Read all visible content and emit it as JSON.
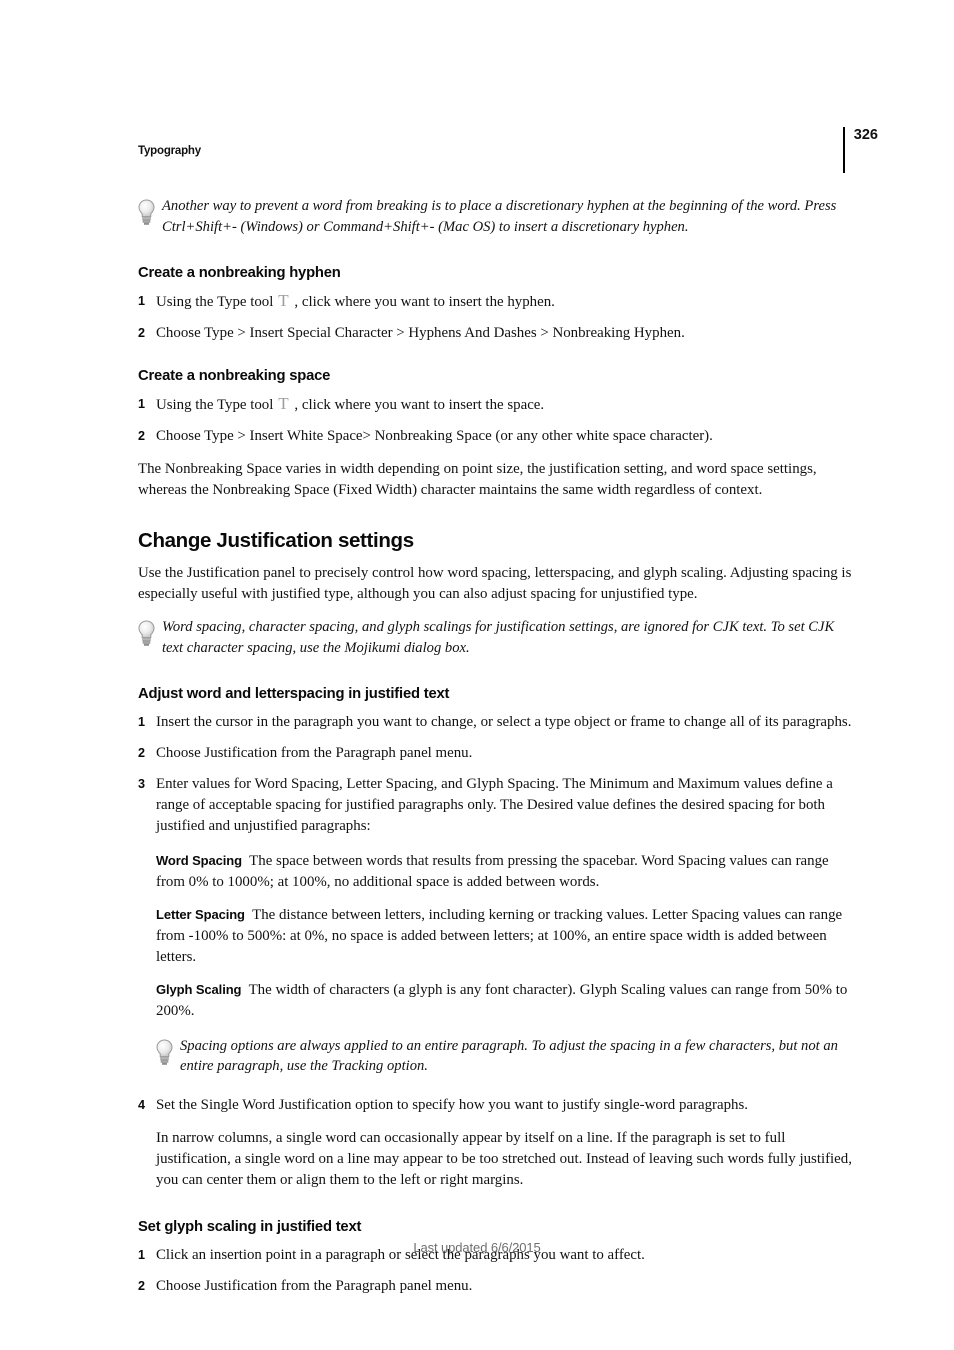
{
  "header": {
    "running_title": "Typography",
    "page_number": "326"
  },
  "tips": {
    "tip1": "Another way to prevent a word from breaking is to place a discretionary hyphen at the beginning of the word. Press Ctrl+Shift+- (Windows) or Command+Shift+- (Mac OS) to insert a discretionary hyphen.",
    "tip2": "Word spacing, character spacing, and glyph scalings for justification settings, are ignored for CJK text. To set CJK text character spacing, use the Mojikumi dialog box.",
    "tip3": "Spacing options are always applied to an entire paragraph. To adjust the spacing in a few characters, but not an entire paragraph, use the Tracking option."
  },
  "sections": {
    "nonbreaking_hyphen": {
      "heading": "Create a nonbreaking hyphen",
      "steps": [
        {
          "num": "1",
          "text_before_icon": "Using the Type tool",
          "text_after_icon": ", click where you want to insert the hyphen."
        },
        {
          "num": "2",
          "text": "Choose Type > Insert Special Character > Hyphens And Dashes > Nonbreaking Hyphen."
        }
      ]
    },
    "nonbreaking_space": {
      "heading": "Create a nonbreaking space",
      "steps": [
        {
          "num": "1",
          "text_before_icon": "Using the Type tool",
          "text_after_icon": ", click where you want to insert the space."
        },
        {
          "num": "2",
          "text": "Choose Type > Insert White Space> Nonbreaking Space (or any other white space character)."
        }
      ],
      "paragraph": "The Nonbreaking Space varies in width depending on point size, the justification setting, and word space settings, whereas the Nonbreaking Space (Fixed Width) character maintains the same width regardless of context."
    },
    "change_justification": {
      "heading": "Change Justification settings",
      "paragraph": "Use the Justification panel to precisely control how word spacing, letterspacing, and glyph scaling. Adjusting spacing is especially useful with justified type, although you can also adjust spacing for unjustified type."
    },
    "adjust_word_letterspacing": {
      "heading": "Adjust word and letterspacing in justified text",
      "steps": [
        {
          "num": "1",
          "text": "Insert the cursor in the paragraph you want to change, or select a type object or frame to change all of its paragraphs."
        },
        {
          "num": "2",
          "text": "Choose Justification from the Paragraph panel menu."
        },
        {
          "num": "3",
          "text": "Enter values for Word Spacing, Letter Spacing, and Glyph Spacing. The Minimum and Maximum values define a range of acceptable spacing for justified paragraphs only. The Desired value defines the desired spacing for both justified and unjustified paragraphs:"
        },
        {
          "num": "4",
          "text": "Set the Single Word Justification option to specify how you want to justify single-word paragraphs."
        }
      ],
      "definitions": [
        {
          "term": "Word Spacing",
          "description": "The space between words that results from pressing the spacebar. Word Spacing values can range from 0% to 1000%; at 100%, no additional space is added between words."
        },
        {
          "term": "Letter Spacing",
          "description": "The distance between letters, including kerning or tracking values. Letter Spacing values can range from -100% to 500%: at 0%, no space is added between letters; at 100%, an entire space width is added between letters."
        },
        {
          "term": "Glyph Scaling",
          "description": "The width of characters (a glyph is any font character). Glyph Scaling values can range from 50% to 200%."
        }
      ],
      "step4_paragraph": "In narrow columns, a single word can occasionally appear by itself on a line. If the paragraph is set to full justification, a single word on a line may appear to be too stretched out. Instead of leaving such words fully justified, you can center them or align them to the left or right margins."
    },
    "set_glyph_scaling": {
      "heading": "Set glyph scaling in justified text",
      "steps": [
        {
          "num": "1",
          "text": "Click an insertion point in a paragraph or select the paragraphs you want to affect."
        },
        {
          "num": "2",
          "text": "Choose Justification from the Paragraph panel menu."
        }
      ]
    }
  },
  "footer": {
    "text": "Last updated 6/6/2015"
  },
  "colors": {
    "text": "#121212",
    "heading": "#0a0a0a",
    "footer": "#6e6e6e",
    "rule": "#000000"
  }
}
